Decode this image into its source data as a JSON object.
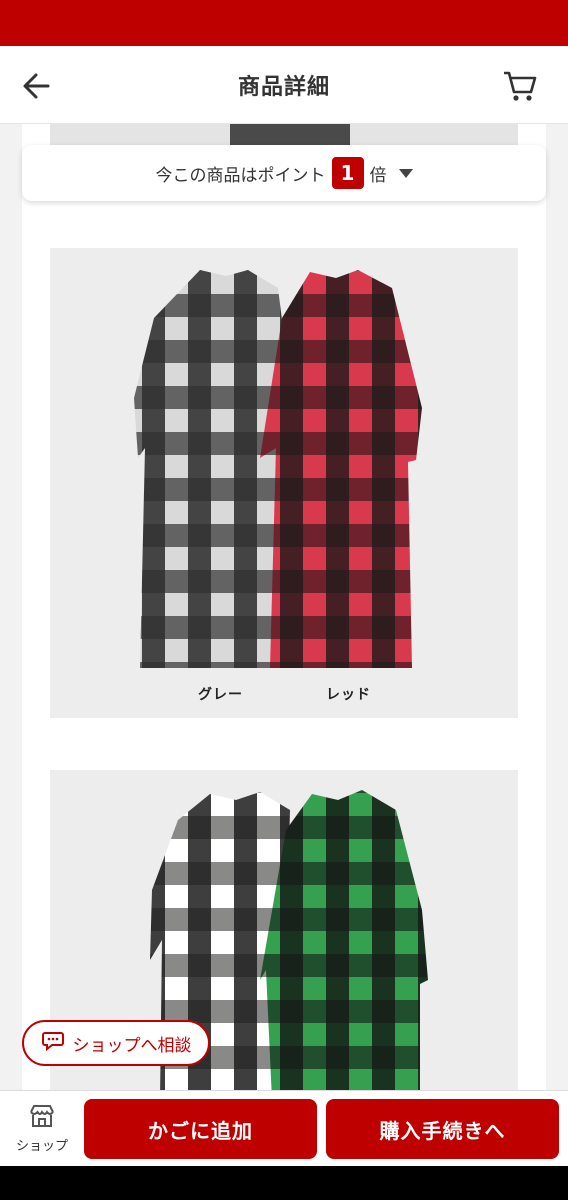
{
  "header": {
    "title": "商品詳細",
    "back_icon": "arrow-left-icon",
    "cart_icon": "cart-icon"
  },
  "point_banner": {
    "prefix": "今この商品はポイント",
    "multiplier": "1",
    "suffix": "倍"
  },
  "photos": [
    {
      "captions": [
        "グレー",
        "レッド"
      ],
      "colors": [
        "#8f8f8f",
        "#c0283a"
      ]
    },
    {
      "captions": [],
      "colors": [
        "#f1f1ee",
        "#1f7a3a"
      ]
    }
  ],
  "consult_button": {
    "label": "ショップへ相談",
    "icon": "chat-icon"
  },
  "bottom_bar": {
    "shop_label": "ショップ",
    "shop_icon": "store-icon",
    "add_to_cart": "かごに追加",
    "checkout": "購入手続きへ"
  },
  "colors": {
    "brand": "#bf0000",
    "background": "#f2f2f2"
  }
}
